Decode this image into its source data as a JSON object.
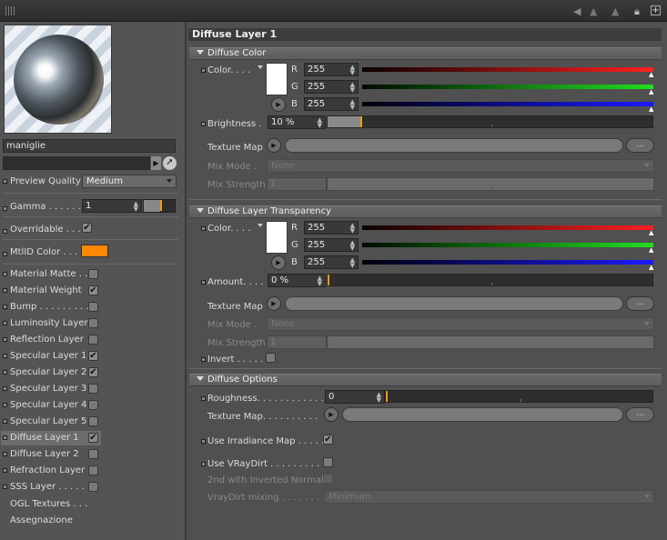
{
  "left": {
    "material_name": "maniglie",
    "search_value": "",
    "preview_quality_label": "Preview Quality",
    "preview_quality_value": "Medium",
    "gamma_label": "Gamma . . . . . .",
    "gamma_value": "1",
    "overridable_label": "Overridable . . .",
    "mtlid_label": "MtlID Color . . .",
    "mtlid_color": "#ff8800",
    "layers": [
      {
        "label": "Material Matte  . .",
        "checked": false
      },
      {
        "label": "Material Weight",
        "checked": true
      },
      {
        "label": "Bump . . . . . . . . .",
        "checked": false
      },
      {
        "label": "Luminosity Layer",
        "checked": false
      },
      {
        "label": "Reflection Layer",
        "checked": false
      },
      {
        "label": "Specular Layer 1",
        "checked": true
      },
      {
        "label": "Specular Layer 2",
        "checked": true
      },
      {
        "label": "Specular Layer 3",
        "checked": false
      },
      {
        "label": "Specular Layer 4",
        "checked": false
      },
      {
        "label": "Specular Layer 5",
        "checked": false
      },
      {
        "label": "Diffuse Layer 1",
        "checked": true
      },
      {
        "label": "Diffuse Layer 2",
        "checked": false
      },
      {
        "label": "Refraction Layer",
        "checked": false
      },
      {
        "label": "SSS Layer  . . . . .",
        "checked": false
      }
    ],
    "ogl_textures": "OGL Textures . . .",
    "assegnazione": "Assegnazione"
  },
  "panel_title": "Diffuse Layer 1",
  "diffuse_color": {
    "header": "Diffuse Color",
    "color_label": "Color. . . .",
    "r_label": "R",
    "g_label": "G",
    "b_label": "B",
    "r": "255",
    "g": "255",
    "b": "255",
    "brightness_label": "Brightness  .",
    "brightness_value": "10 %",
    "brightness_fraction": 0.1,
    "texture_map_label": "Texture Map",
    "texture_btn": "...",
    "mix_mode_label": "Mix Mode  .",
    "mix_mode_value": "None",
    "mix_strength_label": "Mix Strength",
    "mix_strength_value": "1"
  },
  "transparency": {
    "header": "Diffuse Layer Transparency",
    "color_label": "Color. . . .",
    "r_label": "R",
    "g_label": "G",
    "b_label": "B",
    "r": "255",
    "g": "255",
    "b": "255",
    "amount_label": "Amount. . . . .",
    "amount_value": "0 %",
    "texture_map_label": "Texture Map",
    "texture_btn": "...",
    "mix_mode_label": "Mix Mode  .",
    "mix_mode_value": "None",
    "mix_strength_label": "Mix Strength",
    "mix_strength_value": "1",
    "invert_label": "Invert . . . . ."
  },
  "options": {
    "header": "Diffuse Options",
    "roughness_label": "Roughness. . . . . . . . . . . .",
    "roughness_value": "0",
    "texture_map_label": "Texture Map. . . . . . . . . .",
    "texture_btn": "...",
    "irradiance_label": "Use Irradiance Map . . . . .",
    "vraydirt_label": "Use VRayDirt . . . . . . . . . .",
    "inverted_label": "2nd with Inverted Normals",
    "dirt_mix_label": "VrayDirt mixing . . . . . . . . .",
    "dirt_mix_value": "Minimum"
  }
}
